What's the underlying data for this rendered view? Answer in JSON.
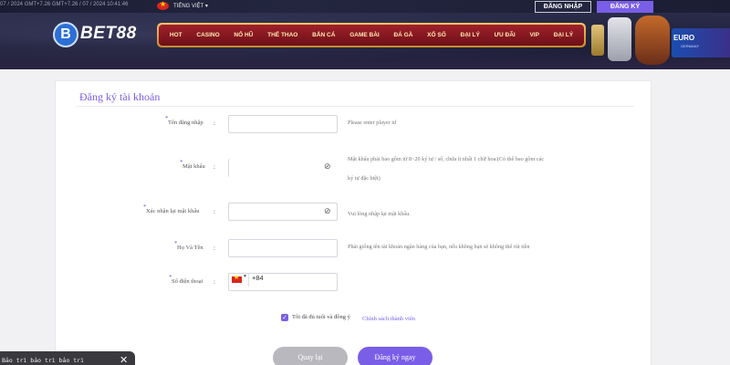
{
  "topbar": {
    "time_text": "07 / 2024 GMT+7.26 GMT+7.26 / 07 / 2024 10:41:46",
    "language": "TIẾNG VIỆT ▾",
    "login_label": "ĐĂNG NHẬP",
    "register_label": "ĐĂNG KÝ"
  },
  "header": {
    "logo_badge": "B",
    "logo_text": "BET88",
    "nav_items": [
      "HOT",
      "CASINO",
      "NỔ HŨ",
      "THỂ THAO",
      "BẮN CÁ",
      "GAME BÀI",
      "ĐÁ GÀ",
      "XỔ SỐ",
      "ĐẠI LÝ",
      "ƯU ĐÃI",
      "VIP",
      "ĐẠI LÝ"
    ],
    "promo_text": "EURO",
    "promo_sub": "GERMANY"
  },
  "form": {
    "title": "Đăng ký tài khoản",
    "required_mark": "*",
    "username": {
      "label": "Tên đăng nhập",
      "colon": ":",
      "value": "",
      "hint": "Please enter player id"
    },
    "password": {
      "label": "Mật khẩu",
      "colon": ":",
      "value": "",
      "hint_line1": "Mật khẩu phải bao gồm từ 8~20 ký tự / số, chứa ít nhất 1 chữ hoa.(Có thể bao gồm các",
      "hint_line2": "ký tự đặc biệt)"
    },
    "confirm_password": {
      "label": "Xác nhận lại mật khẩu",
      "colon": ":",
      "value": "",
      "hint": "Vui lòng nhập lại mật khẩu."
    },
    "fullname": {
      "label": "Họ Và Tên",
      "colon": ":",
      "value": "",
      "hint": "Phải giống tên tài khoản ngân hàng của bạn, nếu không bạn sẽ không thể rút tiền"
    },
    "phone": {
      "label": "Số điện thoại",
      "colon": ":",
      "country_code": "+84"
    },
    "agree_text": "Tôi đã đủ tuổi và đồng ý",
    "agree_link": "Chính sách thành viên",
    "back_label": "Quay lại",
    "submit_label": "Đăng ký ngay"
  },
  "toast": {
    "text": "Bảo trì bảo trì bảo trì",
    "close": "✕"
  },
  "colors": {
    "accent": "#7a5ee8",
    "button_grey": "#b8b8be",
    "nav_red": "#a0202a",
    "nav_gold": "#f3c46a"
  }
}
